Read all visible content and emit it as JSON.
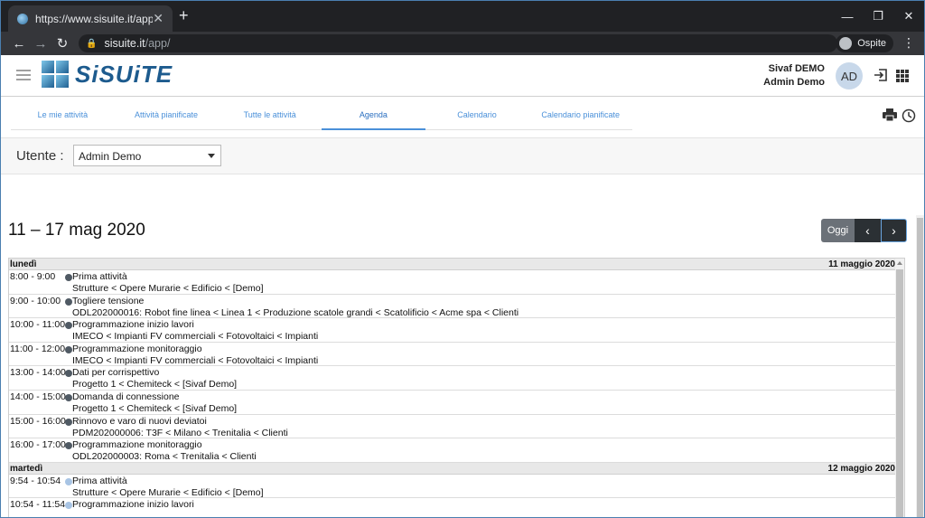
{
  "browser": {
    "tab_title": "https://www.sisuite.it/app/",
    "tab_close": "✕",
    "new_tab": "+",
    "url_host": "sisuite.it",
    "url_path": "/app/",
    "profile_label": "Ospite"
  },
  "header": {
    "logo_text": "SiSUiTE",
    "company": "Sivaf DEMO",
    "user_name": "Admin Demo",
    "avatar_initials": "AD"
  },
  "tabs": [
    {
      "label": "Le mie attività"
    },
    {
      "label": "Attività pianificate"
    },
    {
      "label": "Tutte le attività"
    },
    {
      "label": "Agenda"
    },
    {
      "label": "Calendario"
    },
    {
      "label": "Calendario pianificate"
    }
  ],
  "active_tab": "Agenda",
  "filter": {
    "label": "Utente :",
    "selected": "Admin Demo"
  },
  "calendar": {
    "range_title": "11 – 17 mag 2020",
    "today_label": "Oggi",
    "prev_label": "‹",
    "next_label": "›"
  },
  "days": [
    {
      "name": "lunedì",
      "date": "11 maggio 2020",
      "events": [
        {
          "time": "8:00 - 9:00",
          "title": "Prima attività",
          "subtitle": "Strutture < Opere Murarie < Edificio < [Demo]",
          "color": "#505a64"
        },
        {
          "time": "9:00 - 10:00",
          "title": "Togliere tensione",
          "subtitle": "ODL202000016: Robot fine linea < Linea 1 < Produzione scatole grandi < Scatolificio < Acme spa < Clienti",
          "color": "#505a64"
        },
        {
          "time": "10:00 - 11:00",
          "title": "Programmazione inizio lavori",
          "subtitle": "IMECO < Impianti FV commerciali < Fotovoltaici < Impianti",
          "color": "#505a64"
        },
        {
          "time": "11:00 - 12:00",
          "title": "Programmazione monitoraggio",
          "subtitle": "IMECO < Impianti FV commerciali < Fotovoltaici < Impianti",
          "color": "#505a64"
        },
        {
          "time": "13:00 - 14:00",
          "title": "Dati per corrispettivo",
          "subtitle": "Progetto 1 < Chemiteck < [Sivaf Demo]",
          "color": "#505a64"
        },
        {
          "time": "14:00 - 15:00",
          "title": "Domanda di connessione",
          "subtitle": "Progetto 1 < Chemiteck < [Sivaf Demo]",
          "color": "#505a64"
        },
        {
          "time": "15:00 - 16:00",
          "title": "Rinnovo e varo di nuovi deviatoi",
          "subtitle": "PDM202000006: T3F < Milano < Trenitalia < Clienti",
          "color": "#505a64"
        },
        {
          "time": "16:00 - 17:00",
          "title": "Programmazione monitoraggio",
          "subtitle": "ODL202000003: Roma < Trenitalia < Clienti",
          "color": "#505a64"
        }
      ]
    },
    {
      "name": "martedì",
      "date": "12 maggio 2020",
      "events": [
        {
          "time": "9:54 - 10:54",
          "title": "Prima attività",
          "subtitle": "Strutture < Opere Murarie < Edificio < [Demo]",
          "color": "#a8c4e4"
        },
        {
          "time": "10:54 - 11:54",
          "title": "Programmazione inizio lavori",
          "subtitle": "",
          "color": "#a8c4e4"
        }
      ]
    }
  ]
}
